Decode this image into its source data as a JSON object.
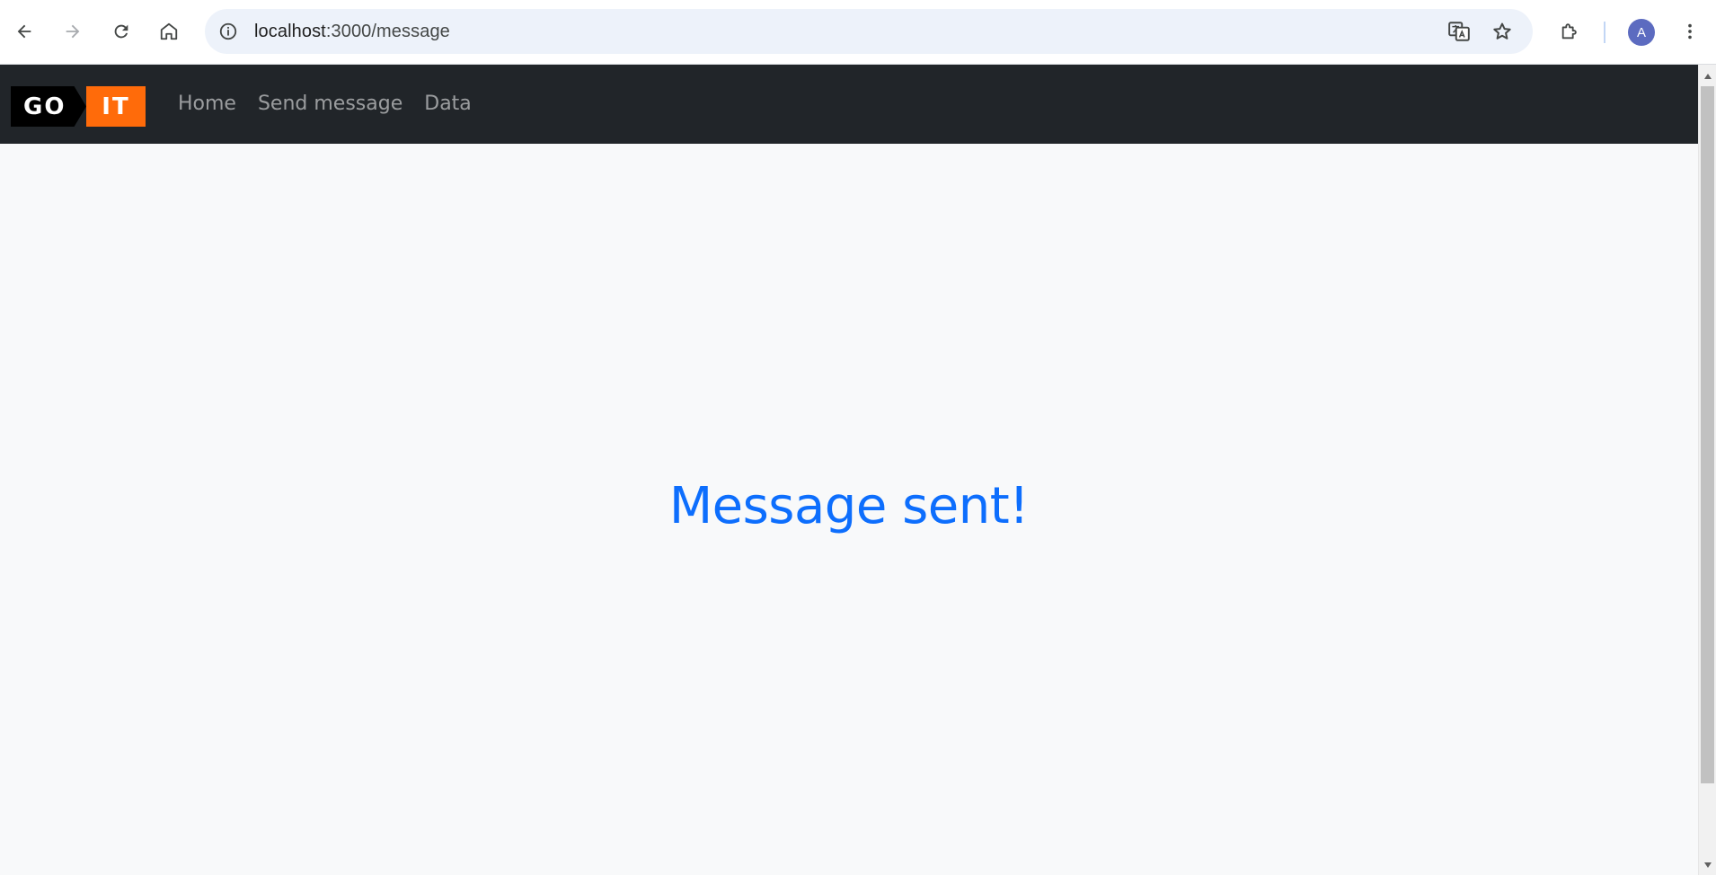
{
  "browser": {
    "url_host": "localhost",
    "url_path": ":3000/message",
    "profile_initial": "A",
    "icons": {
      "back": "arrow-left-icon",
      "forward": "arrow-right-icon",
      "reload": "reload-icon",
      "home": "home-icon",
      "site_info": "info-icon",
      "translate": "translate-icon",
      "bookmark": "star-icon",
      "extensions": "puzzle-icon",
      "menu": "kebab-menu-icon"
    }
  },
  "navbar": {
    "logo_left": "GO",
    "logo_right": "IT",
    "links": [
      {
        "label": "Home"
      },
      {
        "label": "Send message"
      },
      {
        "label": "Data"
      }
    ],
    "colors": {
      "background": "#212529",
      "logo_accent": "#ff6b0a"
    }
  },
  "main": {
    "message": "Message sent!",
    "message_color": "#0d6efd"
  }
}
